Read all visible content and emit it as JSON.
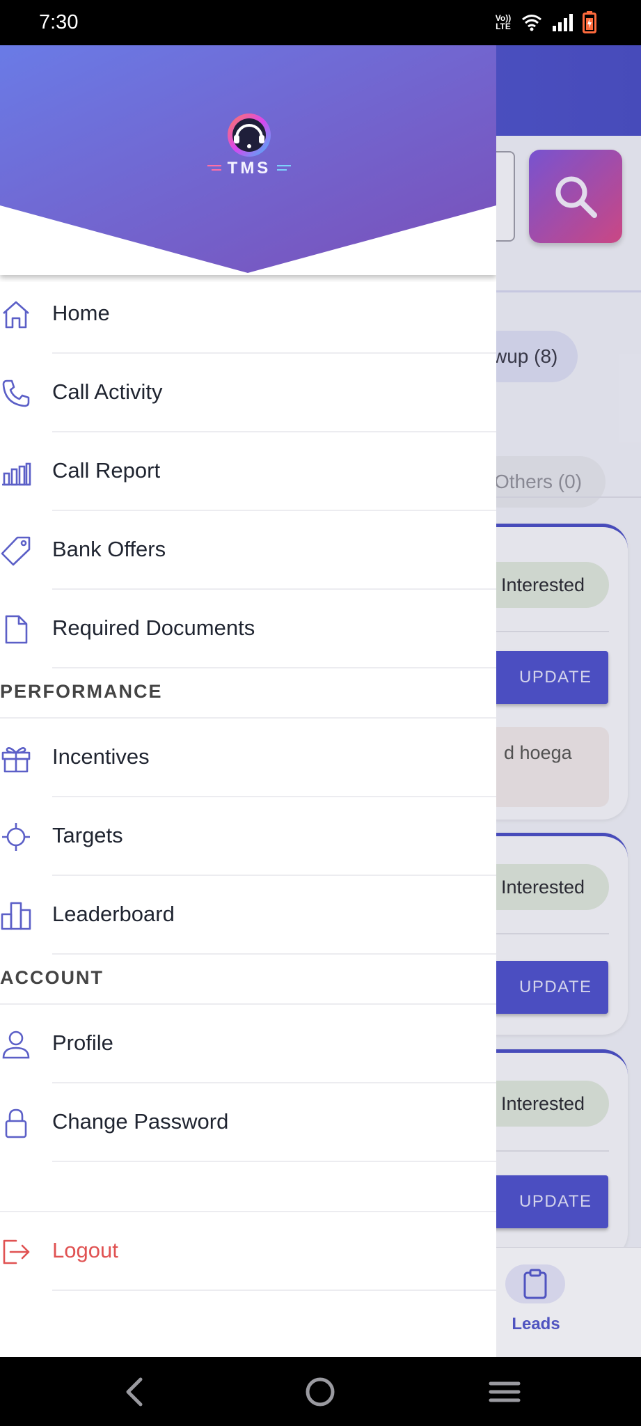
{
  "status_bar": {
    "time": "7:30",
    "volte_label": "Vo)) LTE",
    "icons": [
      "volte-icon",
      "wifi-icon",
      "signal-icon",
      "battery-charging-icon"
    ]
  },
  "background_app": {
    "followup_chip": "wup (8)",
    "others_chip": "Others (0)",
    "cards": [
      {
        "status": "Interested",
        "action": "UPDATE",
        "note": "d hoega"
      },
      {
        "status": "Interested",
        "action": "UPDATE"
      },
      {
        "status": "Interested",
        "action": "UPDATE"
      }
    ],
    "bottom_nav": {
      "leads_label": "Leads"
    },
    "colors": {
      "accent": "#4f52c9",
      "header": "#5a5ed6"
    }
  },
  "drawer": {
    "logo_text": "TMS",
    "header_gradient": [
      "#6a7be6",
      "#7a4fb8"
    ],
    "items": [
      {
        "label": "Home",
        "icon": "home-icon"
      },
      {
        "label": "Call Activity",
        "icon": "phone-icon"
      },
      {
        "label": "Call Report",
        "icon": "bar-chart-icon"
      },
      {
        "label": "Bank Offers",
        "icon": "tag-icon"
      },
      {
        "label": "Required Documents",
        "icon": "document-icon"
      }
    ],
    "sections": {
      "performance": {
        "title": "PERFORMANCE",
        "items": [
          {
            "label": "Incentives",
            "icon": "gift-icon"
          },
          {
            "label": "Targets",
            "icon": "target-icon"
          },
          {
            "label": "Leaderboard",
            "icon": "leaderboard-icon"
          }
        ]
      },
      "account": {
        "title": "ACCOUNT",
        "items": [
          {
            "label": "Profile",
            "icon": "user-icon"
          },
          {
            "label": "Change Password",
            "icon": "lock-icon"
          }
        ]
      }
    },
    "logout": {
      "label": "Logout",
      "icon": "logout-icon",
      "color": "#e05252"
    },
    "icon_color": "#5b5fc7"
  },
  "nav_bar": {
    "buttons": [
      "back-icon",
      "home-circle-icon",
      "recents-icon"
    ]
  }
}
